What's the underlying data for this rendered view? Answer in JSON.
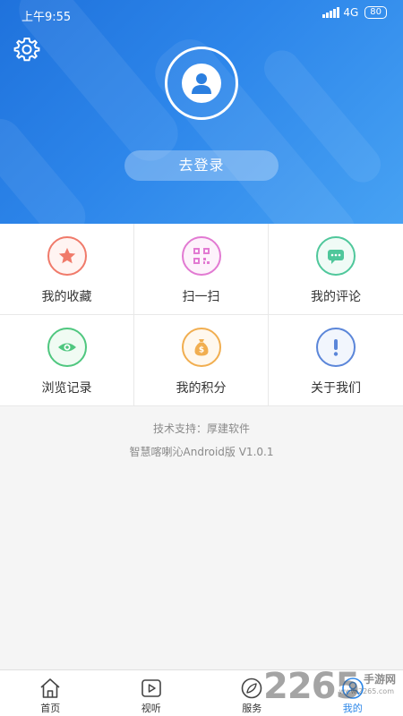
{
  "status_bar": {
    "time": "上午9:55",
    "network": "4G",
    "battery": "80"
  },
  "header": {
    "login_label": "去登录"
  },
  "menu": [
    {
      "label": "我的收藏",
      "icon": "star-icon",
      "color": "#f07a6a"
    },
    {
      "label": "扫一扫",
      "icon": "qrcode-icon",
      "color": "#e27ad2"
    },
    {
      "label": "我的评论",
      "icon": "comment-icon",
      "color": "#4fc79b"
    },
    {
      "label": "浏览记录",
      "icon": "eye-icon",
      "color": "#4fc77f"
    },
    {
      "label": "我的积分",
      "icon": "money-bag-icon",
      "color": "#f1ae50"
    },
    {
      "label": "关于我们",
      "icon": "info-icon",
      "color": "#5b86d9"
    }
  ],
  "info": {
    "support": "技术支持：厚建软件",
    "version": "智慧喀喇沁Android版 V1.0.1"
  },
  "bottom_nav": [
    {
      "label": "首页",
      "icon": "home-icon"
    },
    {
      "label": "视听",
      "icon": "play-icon"
    },
    {
      "label": "服务",
      "icon": "compass-icon"
    },
    {
      "label": "我的",
      "icon": "user-icon",
      "active": true
    }
  ],
  "watermark": {
    "number": "2265",
    "text": "手游网",
    "url": "www.2265.com"
  },
  "colors": {
    "header_start": "#1f72dc",
    "header_end": "#47a2f3",
    "active": "#2b86e8"
  }
}
